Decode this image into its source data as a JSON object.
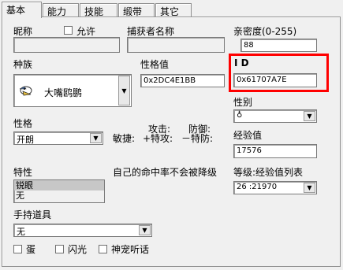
{
  "tabs": [
    "基本",
    "能力",
    "技能",
    "缎带",
    "其它"
  ],
  "nickname": {
    "label": "昵称",
    "allow_label": "允许",
    "value": ""
  },
  "catcher": {
    "label": "捕获者名称",
    "value": ""
  },
  "friendship": {
    "label": "亲密度(0-255)",
    "value": "88"
  },
  "species": {
    "label": "种族",
    "value": "大嘴鸥鹏"
  },
  "personality_value": {
    "label": "性格值",
    "value": "0x2DC4E1BB"
  },
  "id": {
    "label": "I D",
    "value": "0x61707A7E"
  },
  "gender": {
    "label": "性别",
    "value": "♁"
  },
  "nature": {
    "label": "性格",
    "value": "开朗",
    "attack": "攻击:",
    "defense": "防御:",
    "speed": "敏捷:",
    "sp_attack": "+特攻:",
    "sp_defense": "－特防:"
  },
  "experience": {
    "label": "经验值",
    "value": "17576"
  },
  "ability": {
    "label": "特性",
    "items": [
      "锐眼",
      "无"
    ],
    "note": "自己的命中率不会被降级"
  },
  "level": {
    "label": "等级:经验值列表",
    "value": "26 :21970"
  },
  "held_item": {
    "label": "手持道具",
    "value": "无"
  },
  "flags": {
    "egg": "蛋",
    "shiny": "闪光",
    "pokemon_talk": "神宠听话"
  }
}
